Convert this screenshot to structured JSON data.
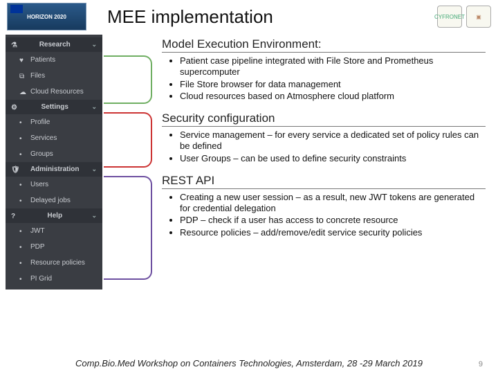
{
  "header": {
    "badge_text": "HORIZON 2020",
    "title": "MEE implementation",
    "logo_right_1": "CYFRONET",
    "logo_right_2": "▣"
  },
  "sidebar": [
    {
      "type": "section",
      "label": "Research",
      "icon": "flask-icon"
    },
    {
      "type": "item",
      "label": "Patients",
      "icon": "heart-icon"
    },
    {
      "type": "item",
      "label": "Files",
      "icon": "copy-icon"
    },
    {
      "type": "item",
      "label": "Cloud Resources",
      "icon": "cloud-icon"
    },
    {
      "type": "section",
      "label": "Settings",
      "icon": "gear-icon"
    },
    {
      "type": "item",
      "label": "Profile",
      "icon": "dot-icon"
    },
    {
      "type": "item",
      "label": "Services",
      "icon": "dot-icon"
    },
    {
      "type": "item",
      "label": "Groups",
      "icon": "dot-icon"
    },
    {
      "type": "section",
      "label": "Administration",
      "icon": "shield-icon"
    },
    {
      "type": "item",
      "label": "Users",
      "icon": "dot-icon"
    },
    {
      "type": "item",
      "label": "Delayed jobs",
      "icon": "dot-icon"
    },
    {
      "type": "section",
      "label": "Help",
      "icon": "help-icon"
    },
    {
      "type": "item",
      "label": "JWT",
      "icon": "dot-icon"
    },
    {
      "type": "item",
      "label": "PDP",
      "icon": "dot-icon"
    },
    {
      "type": "item",
      "label": "Resource policies",
      "icon": "dot-icon"
    },
    {
      "type": "item",
      "label": "PI Grid",
      "icon": "dot-icon"
    }
  ],
  "sections": [
    {
      "title": "Model Execution Environment:",
      "bullets": [
        "Patient case pipeline integrated with File Store and Prometheus supercomputer",
        "File Store browser for data management",
        "Cloud resources based on Atmosphere cloud platform"
      ]
    },
    {
      "title": "Security configuration",
      "bullets": [
        "Service management – for every service a dedicated set of policy rules can be defined",
        "User Groups – can be used to define security constraints"
      ]
    },
    {
      "title": "REST API",
      "bullets": [
        "Creating a new user session – as a result, new JWT tokens are generated for credential delegation",
        "PDP – check if a user has access to concrete resource",
        "Resource policies – add/remove/edit service security policies"
      ]
    }
  ],
  "footer": "Comp.Bio.Med Workshop on Containers Technologies, Amsterdam, 28 -29 March 2019",
  "page_number": "9"
}
